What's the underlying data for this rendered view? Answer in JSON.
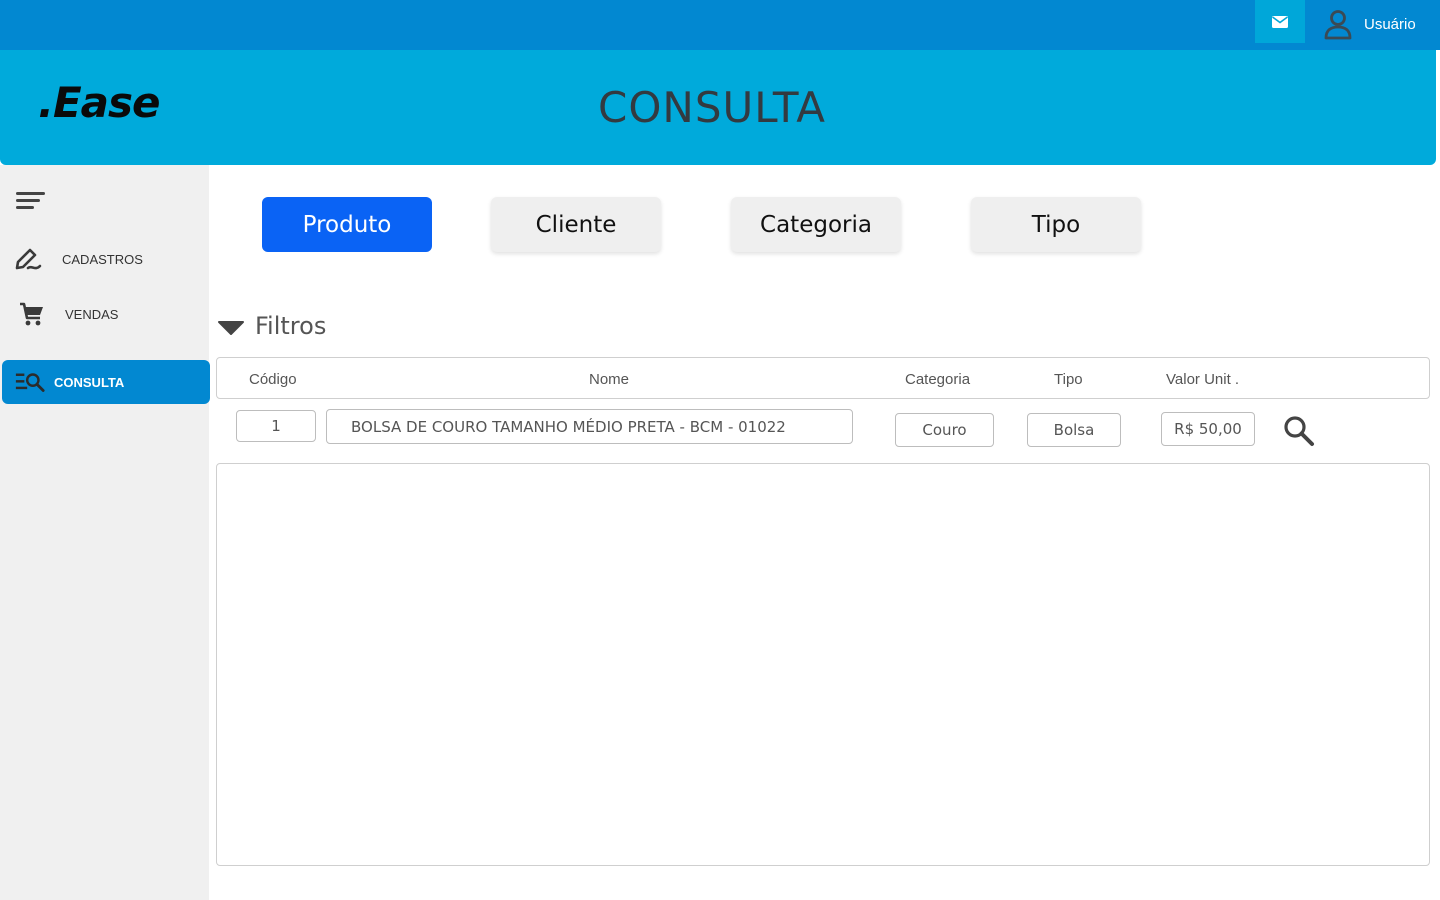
{
  "topbar": {
    "user_label": "Usuário",
    "mail_icon": "envelope-icon",
    "user_icon": "user-icon",
    "bar_color": "#0288d1",
    "mail_bg": "#00a7d9"
  },
  "header": {
    "logo": ".Ease",
    "title": "CONSULTA",
    "color": "#00aadb"
  },
  "sidebar": {
    "toggle_icon": "menu-lines-icon",
    "items": [
      {
        "label": "CADASTROS",
        "icon": "pencil-edit-icon",
        "active": false
      },
      {
        "label": "VENDAS",
        "icon": "shopping-cart-icon",
        "active": false
      },
      {
        "label": "CONSULTA",
        "icon": "list-search-icon",
        "active": true
      }
    ]
  },
  "tabs": [
    {
      "label": "Produto",
      "active": true
    },
    {
      "label": "Cliente",
      "active": false
    },
    {
      "label": "Categoria",
      "active": false
    },
    {
      "label": "Tipo",
      "active": false
    }
  ],
  "filters": {
    "title": "Filtros",
    "columns": {
      "codigo": "Código",
      "nome": "Nome",
      "categoria": "Categoria",
      "tipo": "Tipo",
      "valor": "Valor Unit ."
    },
    "values": {
      "codigo": "1",
      "nome": "BOLSA DE COURO TAMANHO MÉDIO PRETA - BCM - 01022",
      "categoria": "Couro",
      "tipo": "Bolsa",
      "valor": "R$ 50,00"
    }
  },
  "colors": {
    "active_tab": "#0a63f5",
    "active_nav": "#0288d1"
  }
}
